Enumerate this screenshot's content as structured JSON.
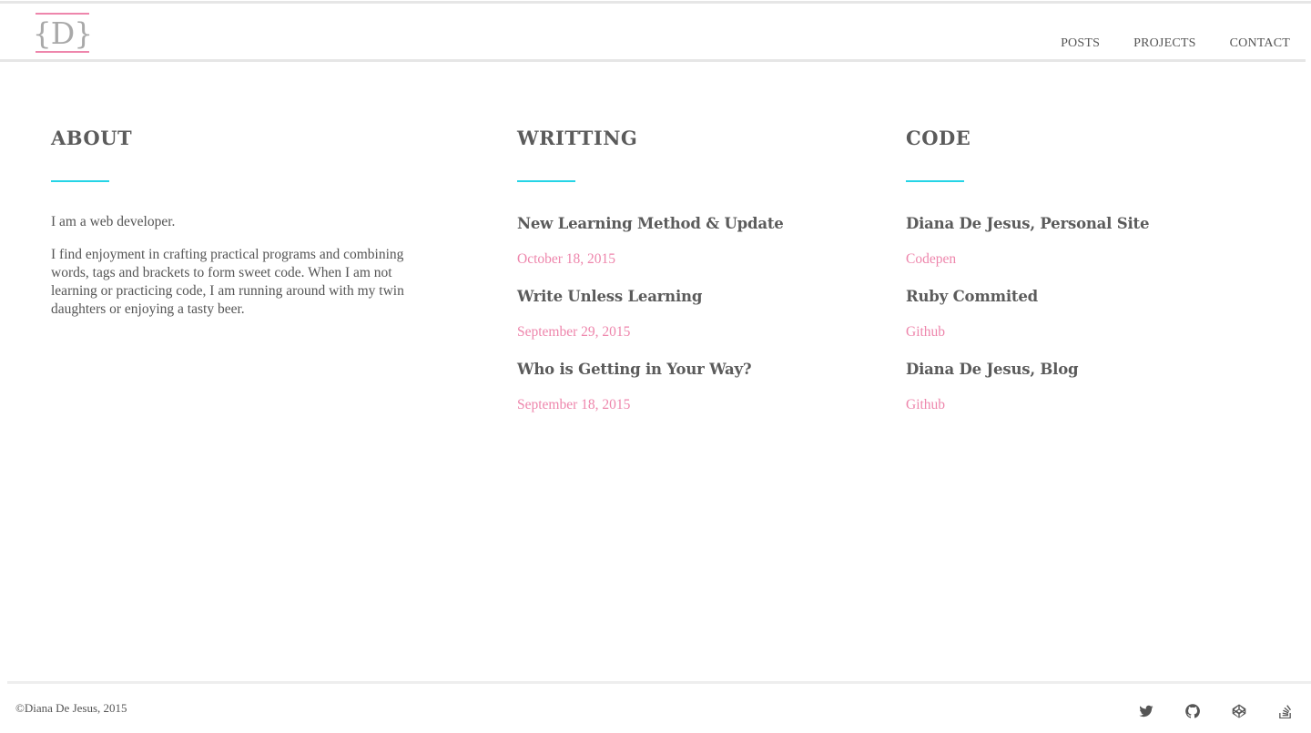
{
  "header": {
    "logo_text": "{D}",
    "nav": [
      "POSTS",
      "PROJECTS",
      "CONTACT"
    ]
  },
  "about": {
    "title": "ABOUT",
    "paragraphs": [
      "I am a web developer.",
      "I find enjoyment in crafting practical programs and combining words, tags and brackets to form sweet code. When I am not learning or practicing code, I am running around with my twin daughters or enjoying a tasty beer."
    ]
  },
  "writing": {
    "title": "WRITTING",
    "posts": [
      {
        "title": "New Learning Method & Update",
        "date": "October 18, 2015"
      },
      {
        "title": "Write Unless Learning",
        "date": "September 29, 2015"
      },
      {
        "title": "Who is Getting in Your Way?",
        "date": "September 18, 2015"
      }
    ]
  },
  "code": {
    "title": "CODE",
    "projects": [
      {
        "title": "Diana De Jesus, Personal Site",
        "source": "Codepen"
      },
      {
        "title": "Ruby Commited",
        "source": "Github"
      },
      {
        "title": "Diana De Jesus, Blog",
        "source": "Github"
      }
    ]
  },
  "footer": {
    "copyright": "©Diana De Jesus, 2015",
    "social_icons": [
      "twitter-icon",
      "github-icon",
      "codepen-icon",
      "stackoverflow-icon"
    ]
  },
  "colors": {
    "accent_pink": "#ee86ac",
    "accent_cyan": "#25d4e6",
    "text": "#555555"
  }
}
